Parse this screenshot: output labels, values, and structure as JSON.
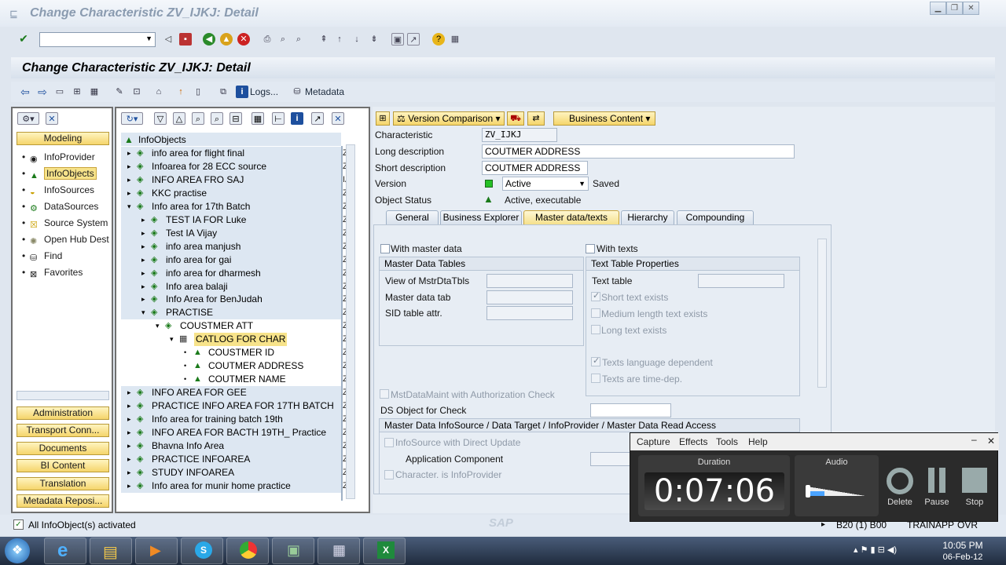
{
  "window": {
    "title": "Change Characteristic ZV_IJKJ: Detail"
  },
  "screen": {
    "title": "Change Characteristic ZV_IJKJ: Detail"
  },
  "appbar": {
    "logs": "Logs...",
    "metadata": "Metadata"
  },
  "nav": {
    "modeling": "Modeling",
    "items": [
      "InfoProvider",
      "InfoObjects",
      "InfoSources",
      "DataSources",
      "Source System",
      "Open Hub Dest",
      "Find",
      "Favorites"
    ],
    "buttons": [
      "Administration",
      "Transport Conn...",
      "Documents",
      "BI Content",
      "Translation",
      "Metadata Reposi..."
    ]
  },
  "tree": {
    "header": "InfoObjects",
    "rows": [
      {
        "label": "info area for flight final",
        "col": "Z"
      },
      {
        "label": "Infoarea for 28 ECC source",
        "col": "Z"
      },
      {
        "label": "INFO AREA FRO SAJ",
        "col": "IA"
      },
      {
        "label": "KKC practise",
        "col": "Z"
      },
      {
        "label": "Info area for 17th Batch",
        "col": "Z"
      },
      {
        "label": "TEST IA FOR Luke",
        "col": "Z"
      },
      {
        "label": "Test IA Vijay",
        "col": "Z"
      },
      {
        "label": "info area manjush",
        "col": "Z"
      },
      {
        "label": "info area for gai",
        "col": "Z"
      },
      {
        "label": "info area for dharmesh",
        "col": "Z"
      },
      {
        "label": "Info area balaji",
        "col": "Z"
      },
      {
        "label": "Info Area for BenJudah",
        "col": "Z"
      },
      {
        "label": "PRACTISE",
        "col": "Z"
      },
      {
        "label": "COUSTMER ATT",
        "col": "Z"
      },
      {
        "label": "CATLOG FOR CHAR",
        "col": "Z"
      },
      {
        "label": "COUSTMER ID",
        "col": "Z"
      },
      {
        "label": "COUTMER ADDRESS",
        "col": "Z"
      },
      {
        "label": "COUTMER NAME",
        "col": "Z"
      },
      {
        "label": "INFO AREA FOR GEE",
        "col": "Z"
      },
      {
        "label": "PRACTICE INFO AREA FOR 17TH BATCH",
        "col": "Z"
      },
      {
        "label": "Info area for training batch 19th",
        "col": "Z"
      },
      {
        "label": "INFO AREA FOR BACTH 19TH_ Practice",
        "col": "Z"
      },
      {
        "label": "Bhavna Info Area",
        "col": "Z"
      },
      {
        "label": "PRACTICE INFOAREA",
        "col": "Z"
      },
      {
        "label": "STUDY INFOAREA",
        "col": "Z"
      },
      {
        "label": "Info area for munir home practice",
        "col": "Z"
      }
    ]
  },
  "detail": {
    "version_comparison": "Version Comparison",
    "business_content": "Business Content",
    "characteristic_label": "Characteristic",
    "characteristic": "ZV_IJKJ",
    "long_desc_label": "Long description",
    "long_desc": "COUTMER ADDRESS",
    "short_desc_label": "Short description",
    "short_desc": "COUTMER ADDRESS",
    "version_label": "Version",
    "version": "Active",
    "version_status": "Saved",
    "status_label": "Object Status",
    "status": "Active, executable",
    "tabs": [
      "General",
      "Business Explorer",
      "Master data/texts",
      "Hierarchy",
      "Compounding"
    ],
    "with_master_data": "With master data",
    "with_texts": "With texts",
    "mdt_header": "Master Data Tables",
    "view_mstr": "View of MstrDtaTbls",
    "master_tab": "Master data tab",
    "sid_attr": "SID table attr.",
    "ttp_header": "Text Table Properties",
    "text_table": "Text table",
    "short_text": "Short text exists",
    "medium_text": "Medium length text exists",
    "long_text": "Long text exists",
    "lang_dep": "Texts language dependent",
    "time_dep": "Texts are time-dep.",
    "auth_check": "MstDataMaint with Authorization Check",
    "ds_object": "DS Object for Check",
    "access_header": "Master Data InfoSource / Data Target / InfoProvider / Master Data Read Access",
    "direct_update": "InfoSource with Direct Update",
    "app_component": "Application Component",
    "char_infoprovider": "Character. is InfoProvider"
  },
  "status": {
    "message": "All InfoObject(s) activated",
    "system": "B20 (1) B00",
    "server": "TRAINAPP",
    "mode": "OVR"
  },
  "recorder": {
    "menu": [
      "Capture",
      "Effects",
      "Tools",
      "Help"
    ],
    "duration_label": "Duration",
    "duration": "0:07:06",
    "audio_label": "Audio",
    "audio_level": 0.3,
    "delete": "Delete",
    "pause": "Pause",
    "stop": "Stop"
  },
  "clock": {
    "time": "10:05 PM",
    "date": "06-Feb-12"
  }
}
